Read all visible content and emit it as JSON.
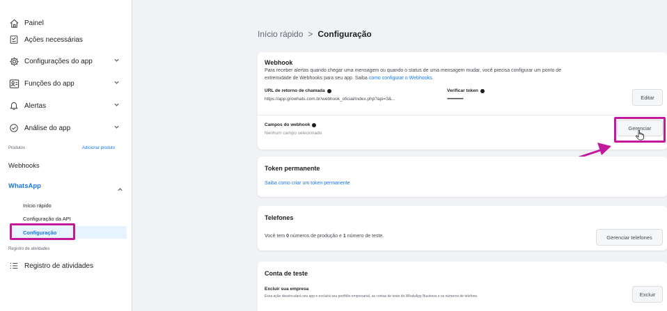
{
  "sidebar": {
    "items": [
      {
        "label": "Painel"
      },
      {
        "label": "Ações necessárias"
      },
      {
        "label": "Configurações do app"
      },
      {
        "label": "Funções do app"
      },
      {
        "label": "Alertas"
      },
      {
        "label": "Análise do app"
      }
    ],
    "products_label": "Produtos",
    "add_product": "Adicionar produto",
    "webhooks": "Webhooks",
    "whatsapp": {
      "label": "WhatsApp",
      "sub": [
        "Início rápido",
        "Configuração da API",
        "Configuração"
      ]
    },
    "activity_section": "Registro de atividades",
    "activity_item": "Registro de atividades"
  },
  "breadcrumb": {
    "root": "Início rápido",
    "separator": ">",
    "current": "Configuração"
  },
  "webhook": {
    "title": "Webhook",
    "desc_1": "Para receber alertas quando chegar uma mensagem ou quando o status de uma mensagem mudar, você precisa configurar um ponto de",
    "desc_2": "extremidade de Webhooks para seu app. Saiba ",
    "desc_link": "como configurar o Webhooks",
    "desc_end": ".",
    "callback_label": "URL de retorno de chamada",
    "callback_value": "https://app.growhats.com.br/webhook_oficial/index.php?api=3&...",
    "token_label": "Verificar token",
    "token_value": "••••••••••••••••••",
    "edit_button": "Editar",
    "fields_label": "Campos do webhook",
    "fields_value": "Nenhum campo selecionado",
    "manage_button": "Gerenciar"
  },
  "token": {
    "title": "Token permanente",
    "link": "Saiba como criar um token permanente"
  },
  "phones": {
    "title": "Telefones",
    "text_1": "Você tem ",
    "num_prod": "0",
    "text_2": " números de produção e ",
    "num_test": "1",
    "text_3": " número de teste.",
    "button": "Gerenciar telefones"
  },
  "test_account": {
    "title": "Conta de teste",
    "delete_label": "Excluir sua empresa",
    "delete_desc": "Essa ação desvinculará seu app e excluirá seu portfólio empresarial, as contas de teste do WhatsApp Business e os números de telefone.",
    "delete_button": "Excluir"
  },
  "colors": {
    "accent": "#1877f2",
    "highlight": "#c2189e",
    "background": "#f0f2f5"
  }
}
